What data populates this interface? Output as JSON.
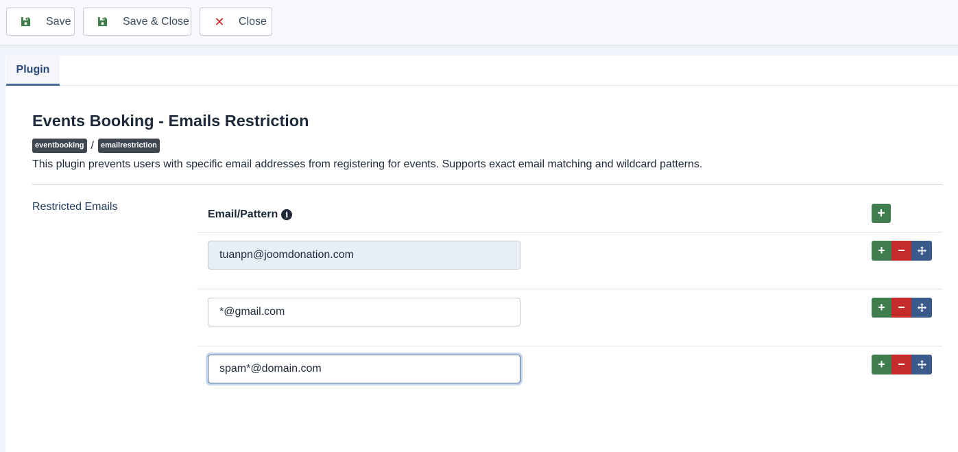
{
  "toolbar": {
    "save_label": "Save",
    "save_close_label": "Save & Close",
    "close_label": "Close"
  },
  "tabs": [
    {
      "label": "Plugin"
    }
  ],
  "plugin": {
    "title": "Events Booking - Emails Restriction",
    "badges": [
      "eventbooking",
      "emailrestriction"
    ],
    "badge_separator": "/",
    "description": "This plugin prevents users with specific email addresses from registering for events. Supports exact email matching and wildcard patterns."
  },
  "field": {
    "label": "Restricted Emails",
    "column_header": "Email/Pattern",
    "rows": [
      {
        "value": "tuanpn@joomdonation.com"
      },
      {
        "value": "*@gmail.com"
      },
      {
        "value": "spam*@domain.com"
      }
    ]
  },
  "icons": {
    "save": "floppy-disk-icon",
    "close": "x-icon",
    "info": "info-circle-icon",
    "add": "plus-icon",
    "remove": "minus-icon",
    "move": "move-arrows-icon"
  },
  "colors": {
    "add": "#3f7d4f",
    "remove": "#c42b2b",
    "move": "#3a5a8c",
    "badge": "#3e4650",
    "tab_accent": "#4a6a96"
  }
}
